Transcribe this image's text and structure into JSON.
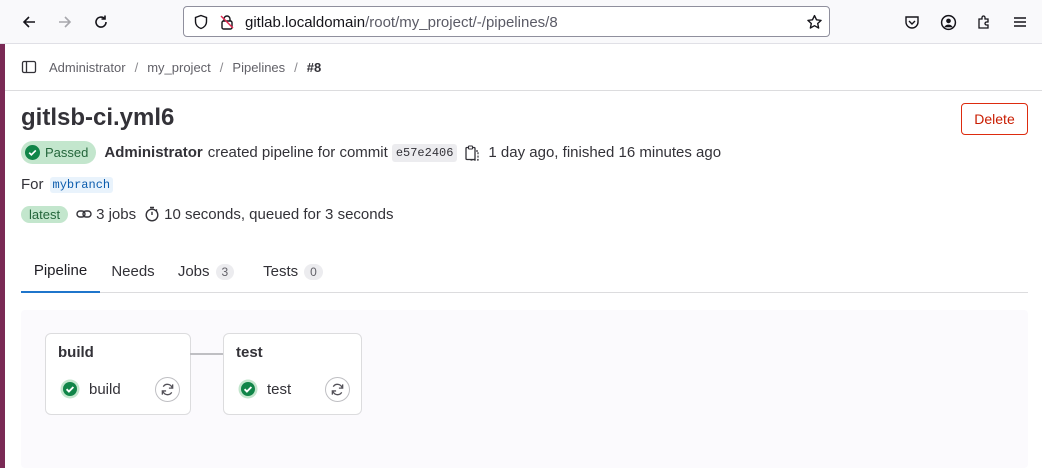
{
  "browser": {
    "url_host": "gitlab.localdomain",
    "url_path": "/root/my_project/-/pipelines/8"
  },
  "breadcrumb": [
    "Administrator",
    "my_project",
    "Pipelines",
    "#8"
  ],
  "header": {
    "title": "gitlsb-ci.yml6",
    "delete_label": "Delete",
    "status": "Passed",
    "author": "Administrator",
    "action_text": "created pipeline for commit",
    "commit_sha": "e57e2406",
    "timing": "1 day ago, finished 16 minutes ago",
    "for_label": "For",
    "branch": "mybranch",
    "latest_badge": "latest",
    "jobs_text": "3 jobs",
    "duration_text": "10 seconds, queued for 3 seconds"
  },
  "tabs": [
    {
      "label": "Pipeline"
    },
    {
      "label": "Needs"
    },
    {
      "label": "Jobs",
      "count": "3"
    },
    {
      "label": "Tests",
      "count": "0"
    }
  ],
  "stages": [
    {
      "name": "build",
      "job": "build"
    },
    {
      "name": "test",
      "job": "test"
    }
  ],
  "colors": {
    "success": "#108548",
    "link": "#1f75cb",
    "danger": "#dd2b0e"
  },
  "icons": [
    "back-arrow-icon",
    "forward-arrow-icon",
    "reload-icon",
    "shield-icon",
    "lock-icon",
    "star-icon",
    "pocket-icon",
    "account-icon",
    "extensions-icon",
    "menu-icon",
    "sidebar-toggle-icon",
    "check-circle-icon",
    "copy-icon",
    "link-icon",
    "timer-icon",
    "retry-icon"
  ]
}
